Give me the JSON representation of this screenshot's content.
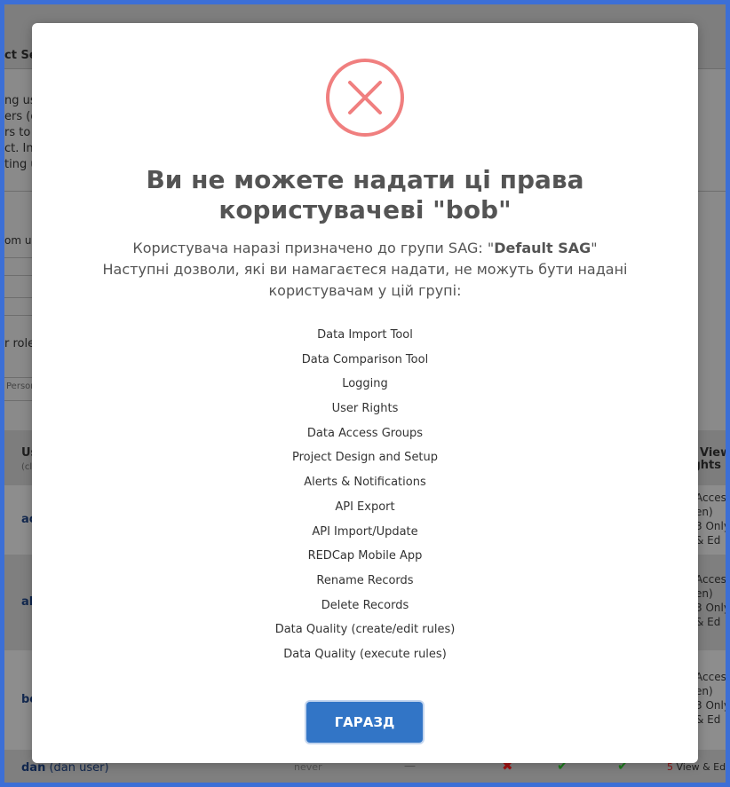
{
  "background": {
    "header_fragment": "ct Se",
    "intro_fragments": [
      "ng use",
      "ers (o",
      "rs to a",
      "ct. In",
      "ting u"
    ],
    "filter_fragments": [
      "om us",
      "r role",
      "Persor"
    ],
    "table_header": {
      "user_col_fragment": "Us",
      "user_col_sub": "(cl",
      "view_col": "View",
      "rights_col": "ights"
    },
    "rows": [
      {
        "user_fragment": "ac",
        "rights": [
          "Access",
          "en)",
          "3 Only",
          "& Ed"
        ]
      },
      {
        "user_fragment": "al",
        "rights": [
          "Access",
          "en)",
          "3 Only",
          "& Ed"
        ]
      },
      {
        "user_fragment": "bo",
        "rights": [
          "Access",
          "en)",
          "3 Only",
          "& Ed"
        ]
      }
    ],
    "last_row": {
      "username": "dan",
      "fullname": "(dan user)",
      "expiration": "never",
      "dash": "—",
      "rights_count": "5",
      "rights_text": "View & Edi"
    }
  },
  "modal": {
    "title": "Ви не можете надати ці права користувачеві \"bob\"",
    "body_prefix": "Користувача наразі призначено до групи SAG: \"",
    "sag_name": "Default SAG",
    "body_suffix": "\"",
    "body_line2": "Наступні дозволи, які ви намагаєтеся надати, не можуть бути надані користувачам у цій групі:",
    "permissions": [
      "Data Import Tool",
      "Data Comparison Tool",
      "Logging",
      "User Rights",
      "Data Access Groups",
      "Project Design and Setup",
      "Alerts & Notifications",
      "API Export",
      "API Import/Update",
      "REDCap Mobile App",
      "Rename Records",
      "Delete Records",
      "Data Quality (create/edit rules)",
      "Data Quality (execute rules)"
    ],
    "ok_label": "ГАРАЗД",
    "icon": "error-x-circle-icon"
  },
  "colors": {
    "error": "#f07f7f",
    "button": "#3275c6",
    "title": "#545454",
    "frame": "#3c6fd6"
  }
}
